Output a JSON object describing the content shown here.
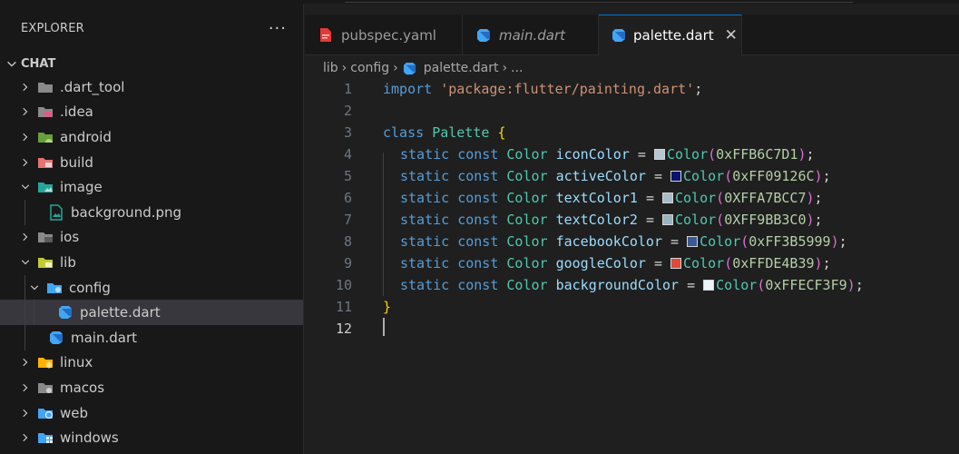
{
  "sidebar": {
    "title": "EXPLORER",
    "more": "···",
    "section": "CHAT",
    "items": [
      {
        "label": ".dart_tool",
        "icon": "folder-icon",
        "color": "#8a8a8a"
      },
      {
        "label": ".idea",
        "icon": "folder-idea-icon",
        "color": "#8a8a8a"
      },
      {
        "label": "android",
        "icon": "folder-android-icon",
        "color": "#8bc34a"
      },
      {
        "label": "build",
        "icon": "folder-build-icon",
        "color": "#e57373"
      },
      {
        "label": "image",
        "icon": "folder-images-icon",
        "color": "#26a69a"
      },
      {
        "label": "background.png",
        "icon": "image-file-icon",
        "color": "#26a69a"
      },
      {
        "label": "ios",
        "icon": "folder-ios-icon",
        "color": "#8a8a8a"
      },
      {
        "label": "lib",
        "icon": "folder-lib-icon",
        "color": "#c0ca33"
      },
      {
        "label": "config",
        "icon": "folder-config-icon",
        "color": "#42a5f5"
      },
      {
        "label": "palette.dart",
        "icon": "dart-icon",
        "color": "#42a5f5"
      },
      {
        "label": "main.dart",
        "icon": "dart-icon",
        "color": "#42a5f5"
      },
      {
        "label": "linux",
        "icon": "folder-linux-icon",
        "color": "#ffb300"
      },
      {
        "label": "macos",
        "icon": "folder-macos-icon",
        "color": "#8a8a8a"
      },
      {
        "label": "web",
        "icon": "folder-web-icon",
        "color": "#42a5f5"
      },
      {
        "label": "windows",
        "icon": "folder-windows-icon",
        "color": "#42a5f5"
      }
    ]
  },
  "tabs": [
    {
      "label": "pubspec.yaml",
      "icon": "yaml-icon",
      "active": false
    },
    {
      "label": "main.dart",
      "icon": "dart-icon",
      "active": false
    },
    {
      "label": "palette.dart",
      "icon": "dart-icon",
      "active": true,
      "close": "✕"
    }
  ],
  "breadcrumb": {
    "parts": [
      "lib",
      "config",
      "palette.dart",
      "..."
    ],
    "sep": "›"
  },
  "editor": {
    "line_numbers": [
      "1",
      "2",
      "3",
      "4",
      "5",
      "6",
      "7",
      "8",
      "9",
      "10",
      "11",
      "12"
    ],
    "current_line": "12",
    "import_kw": "import",
    "import_str": "'package:flutter/painting.dart'",
    "semicolon": ";",
    "class_kw": "class",
    "class_name": "Palette",
    "open_brace": "{",
    "close_brace": "}",
    "static_kw": "static",
    "const_kw": "const",
    "type": "Color",
    "fields": [
      {
        "name": "iconColor",
        "value": "0xFFB6C7D1",
        "swatch": "#b6c7d1"
      },
      {
        "name": "activeColor",
        "value": "0xFF09126C",
        "swatch": "#09126c"
      },
      {
        "name": "textColor1",
        "value": "0XFFA7BCC7",
        "swatch": "#a7bcc7"
      },
      {
        "name": "textColor2",
        "value": "0XFF9BB3C0",
        "swatch": "#9bb3c0"
      },
      {
        "name": "facebookColor",
        "value": "0xFF3B5999",
        "swatch": "#3b5999"
      },
      {
        "name": "googleColor",
        "value": "0xFFDE4B39",
        "swatch": "#de4b39"
      },
      {
        "name": "backgroundColor",
        "value": "0xFFECF3F9",
        "swatch": "#ecf3f9"
      }
    ]
  }
}
